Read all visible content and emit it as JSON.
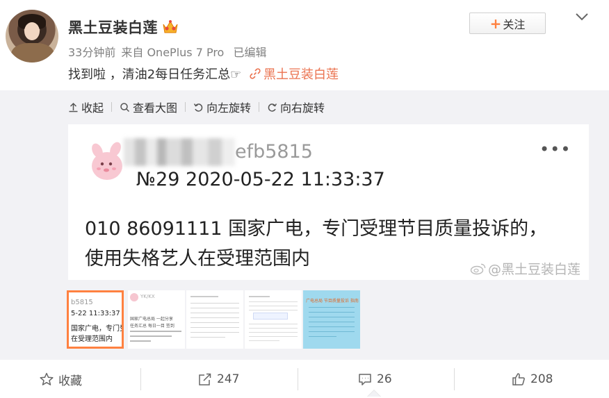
{
  "post": {
    "user_name": "黑土豆装白莲",
    "time": "33分钟前",
    "source": "来自 OnePlus 7 Pro",
    "edited": "已编辑",
    "follow_label": "关注",
    "text": "找到啦 ，清油2每日任务汇总☞",
    "link_text": "黑土豆装白莲"
  },
  "toolbar": {
    "collapse": "收起",
    "view_large": "查看大图",
    "rotate_left": "向左旋转",
    "rotate_right": "向右旋转"
  },
  "image": {
    "user_id": "efb5815",
    "number_time": "№29  2020-05-22 11:33:37",
    "line1": "010 86091111 国家广电，专门受理节目质量投诉的，",
    "line2": "使用失格艺人在受理范围内",
    "watermark": "@黑土豆装白莲",
    "more": "•••"
  },
  "thumb1": {
    "l1": "b5815",
    "l2": "5-22 11:33:37",
    "l3": "国家广电，专门受理节",
    "l4": "在受理范围内"
  },
  "thumb2": {
    "l1": "YK/KX",
    "l2": "国家广电总局 一起分享",
    "l3": "任务汇总 每日一目 签到"
  },
  "thumb5": {
    "l1": "广电总局 节目质量投诉 指南"
  },
  "actions": {
    "favorite": "收藏",
    "repost": "247",
    "comment": "26",
    "like": "208"
  },
  "colors": {
    "accent": "#ff8140",
    "link": "#eb7350",
    "media_bg": "#f2f2f5"
  }
}
